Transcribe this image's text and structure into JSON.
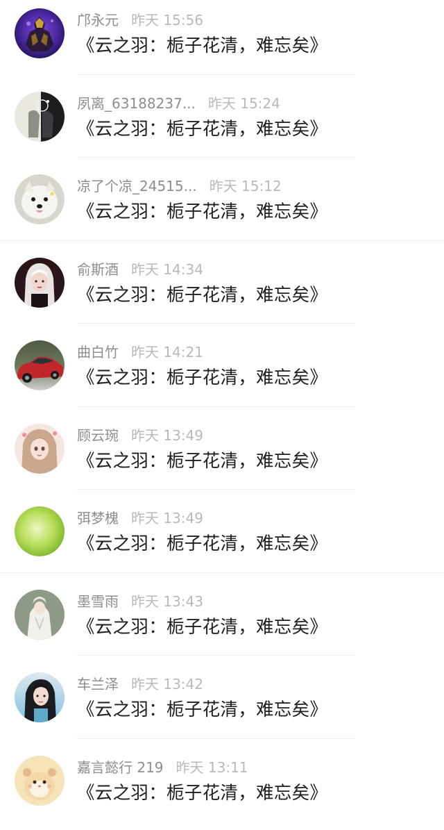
{
  "comments": [
    {
      "username": "邝永元",
      "time": "昨天 15:56",
      "text": "《云之羽：栀子花清，难忘矣》",
      "avatar_icon": "armored-warrior-avatar"
    },
    {
      "username": "夙离_63188237...",
      "time": "昨天 15:24",
      "text": "《云之羽：栀子花清，难忘矣》",
      "avatar_icon": "half-dark-figure-avatar"
    },
    {
      "username": "凉了个凉_24515...",
      "time": "昨天 15:12",
      "text": "《云之羽：栀子花清，难忘矣》",
      "avatar_icon": "white-dog-avatar"
    },
    {
      "username": "俞斯酒",
      "time": "昨天 14:34",
      "text": "《云之羽：栀子花清，难忘矣》",
      "avatar_icon": "white-haired-girl-avatar"
    },
    {
      "username": "曲白竹",
      "time": "昨天 14:21",
      "text": "《云之羽：栀子花清，难忘矣》",
      "avatar_icon": "red-car-avatar"
    },
    {
      "username": "顾云琬",
      "time": "昨天 13:49",
      "text": "《云之羽：栀子花清，难忘矣》",
      "avatar_icon": "anime-girl-avatar"
    },
    {
      "username": "弭梦槐",
      "time": "昨天 13:49",
      "text": "《云之羽：栀子花清，难忘矣》",
      "avatar_icon": "green-gradient-avatar"
    },
    {
      "username": "墨雪雨",
      "time": "昨天 13:43",
      "text": "《云之羽：栀子花清，难忘矣》",
      "avatar_icon": "white-robed-figure-avatar"
    },
    {
      "username": "车兰泽",
      "time": "昨天 13:42",
      "text": "《云之羽：栀子花清，难忘矣》",
      "avatar_icon": "dark-haired-girl-avatar"
    },
    {
      "username": "嘉言懿行 219",
      "time": "昨天 13:11",
      "text": "《云之羽：栀子花清，难忘矣》",
      "avatar_icon": "hamster-avatar"
    }
  ],
  "colors": {
    "background": "#ffffff",
    "username": "#8d8d8d",
    "time": "#b9b9b9",
    "comment": "#1e1e1e",
    "divider": "#f1f1f1"
  }
}
